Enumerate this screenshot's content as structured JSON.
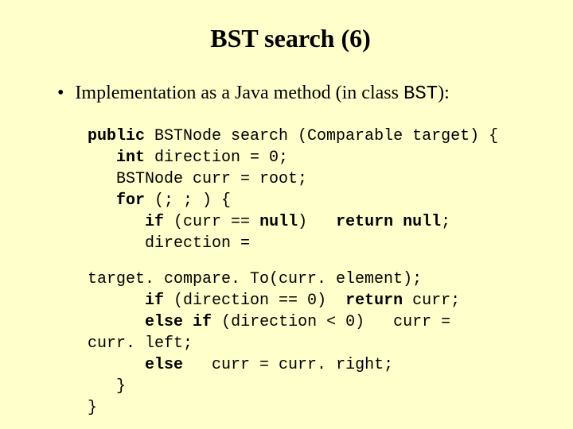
{
  "title": "BST search (6)",
  "bullet": {
    "prefix": "Implementation as a Java method (in class ",
    "classname": "BST",
    "suffix": "):"
  },
  "code": {
    "kw_public": "public",
    "l1_a": " BSTNode search (Comparable target) {",
    "kw_int": "int",
    "l2_a": " direction = 0;",
    "l3": "   BSTNode curr = root;",
    "kw_for": "for",
    "l4_a": " (; ; ) {",
    "kw_if": "if",
    "l5_a": " (curr == ",
    "kw_null1": "null",
    "l5_b": ")   ",
    "kw_return1": "return",
    "l5_c": " ",
    "kw_null2": "null",
    "l5_d": ";",
    "l6": "      direction =",
    "l7": "target. compare. To(curr. element);",
    "l8_a": " (direction == 0)  ",
    "kw_return2": "return",
    "l8_b": " curr;",
    "kw_else1": "else",
    "l9_a": " ",
    "kw_if2": "if",
    "l9_b": " (direction < 0)   curr =",
    "l10": "curr. left;",
    "kw_else2": "else",
    "l11_a": "   curr = curr. right;",
    "l12": "   }",
    "l13": "}"
  }
}
